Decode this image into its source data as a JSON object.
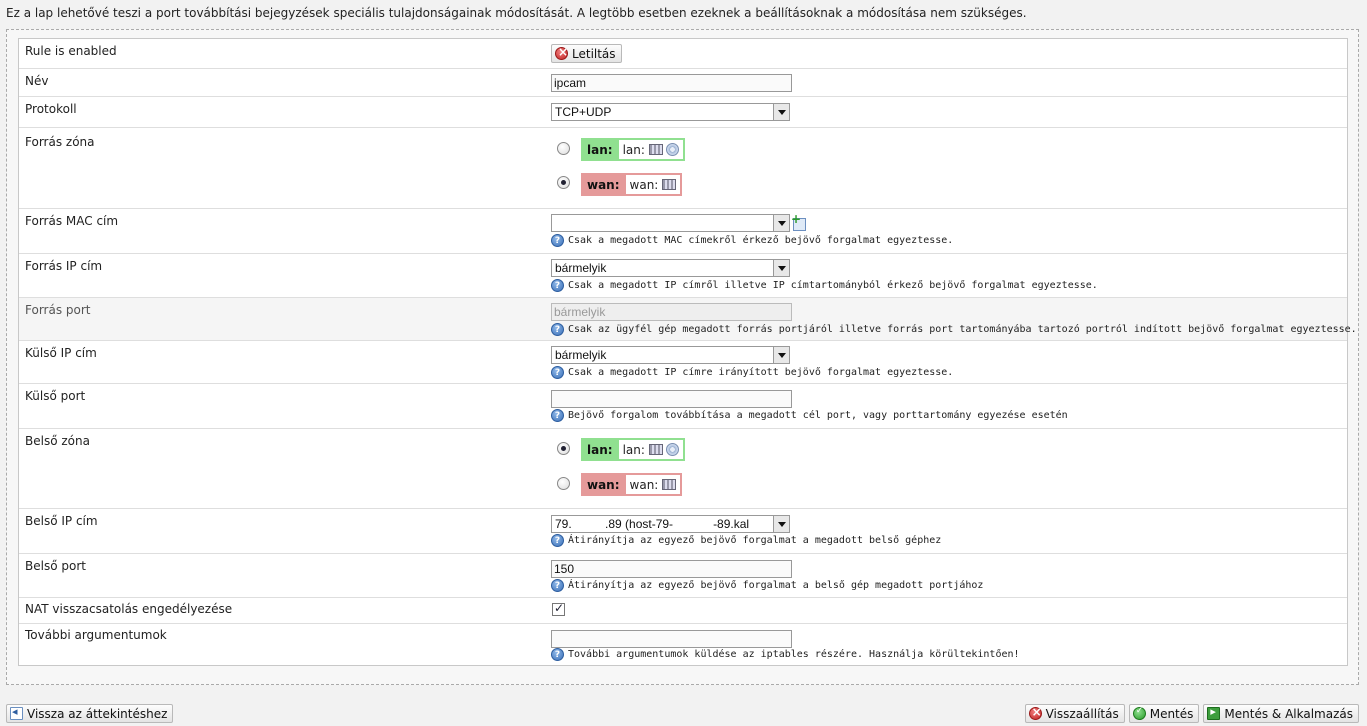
{
  "intro_text": "Ez a lap lehetővé teszi a port továbbítási bejegyzések speciális tulajdonságainak módosítását. A legtöbb esetben ezeknek a beállításoknak a módosítása nem szükséges.",
  "rows": {
    "enabled": {
      "label": "Rule is enabled",
      "button": "Letiltás"
    },
    "name": {
      "label": "Név",
      "value": "ipcam"
    },
    "protocol": {
      "label": "Protokoll",
      "value": "TCP+UDP"
    },
    "src_zone": {
      "label": "Forrás zóna",
      "lan_name": "lan:",
      "lan_iface": "lan:",
      "wan_name": "wan:",
      "wan_iface": "wan:",
      "selected": "wan"
    },
    "src_mac": {
      "label": "Forrás MAC cím",
      "value": "",
      "hint": "Csak a megadott MAC címekről érkező bejövő forgalmat egyeztesse."
    },
    "src_ip": {
      "label": "Forrás IP cím",
      "value": "bármelyik",
      "hint": "Csak a megadott IP címről illetve IP címtartományból érkező bejövő forgalmat egyeztesse."
    },
    "src_port": {
      "label": "Forrás port",
      "placeholder": "bármelyik",
      "hint": "Csak az ügyfél gép megadott forrás portjáról illetve forrás port tartományába tartozó portról indított bejövő forgalmat egyeztesse."
    },
    "ext_ip": {
      "label": "Külső IP cím",
      "value": "bármelyik",
      "hint": "Csak a megadott IP címre irányított bejövő forgalmat egyeztesse."
    },
    "ext_port": {
      "label": "Külső port",
      "value": "",
      "hint": "Bejövő forgalom továbbítása a megadott cél port, vagy porttartomány egyezése esetén"
    },
    "dest_zone": {
      "label": "Belső zóna",
      "lan_name": "lan:",
      "lan_iface": "lan:",
      "wan_name": "wan:",
      "wan_iface": "wan:",
      "selected": "lan"
    },
    "int_ip": {
      "label": "Belső IP cím",
      "value": "79.          .89 (host-79-            -89.kal",
      "hint": "Átirányítja az egyező bejövő forgalmat a megadott belső géphez"
    },
    "int_port": {
      "label": "Belső port",
      "value": "150",
      "hint": "Átirányítja az egyező bejövő forgalmat a belső gép megadott portjához"
    },
    "nat_reflection": {
      "label": "NAT visszacsatolás engedélyezése",
      "checked": true
    },
    "extra_args": {
      "label": "További argumentumok",
      "value": "",
      "hint": "További argumentumok küldése az iptables részére. Használja körültekintően!"
    }
  },
  "footer": {
    "back": "Vissza az áttekintéshez",
    "reset": "Visszaállítás",
    "save": "Mentés",
    "save_apply": "Mentés & Alkalmazás"
  }
}
